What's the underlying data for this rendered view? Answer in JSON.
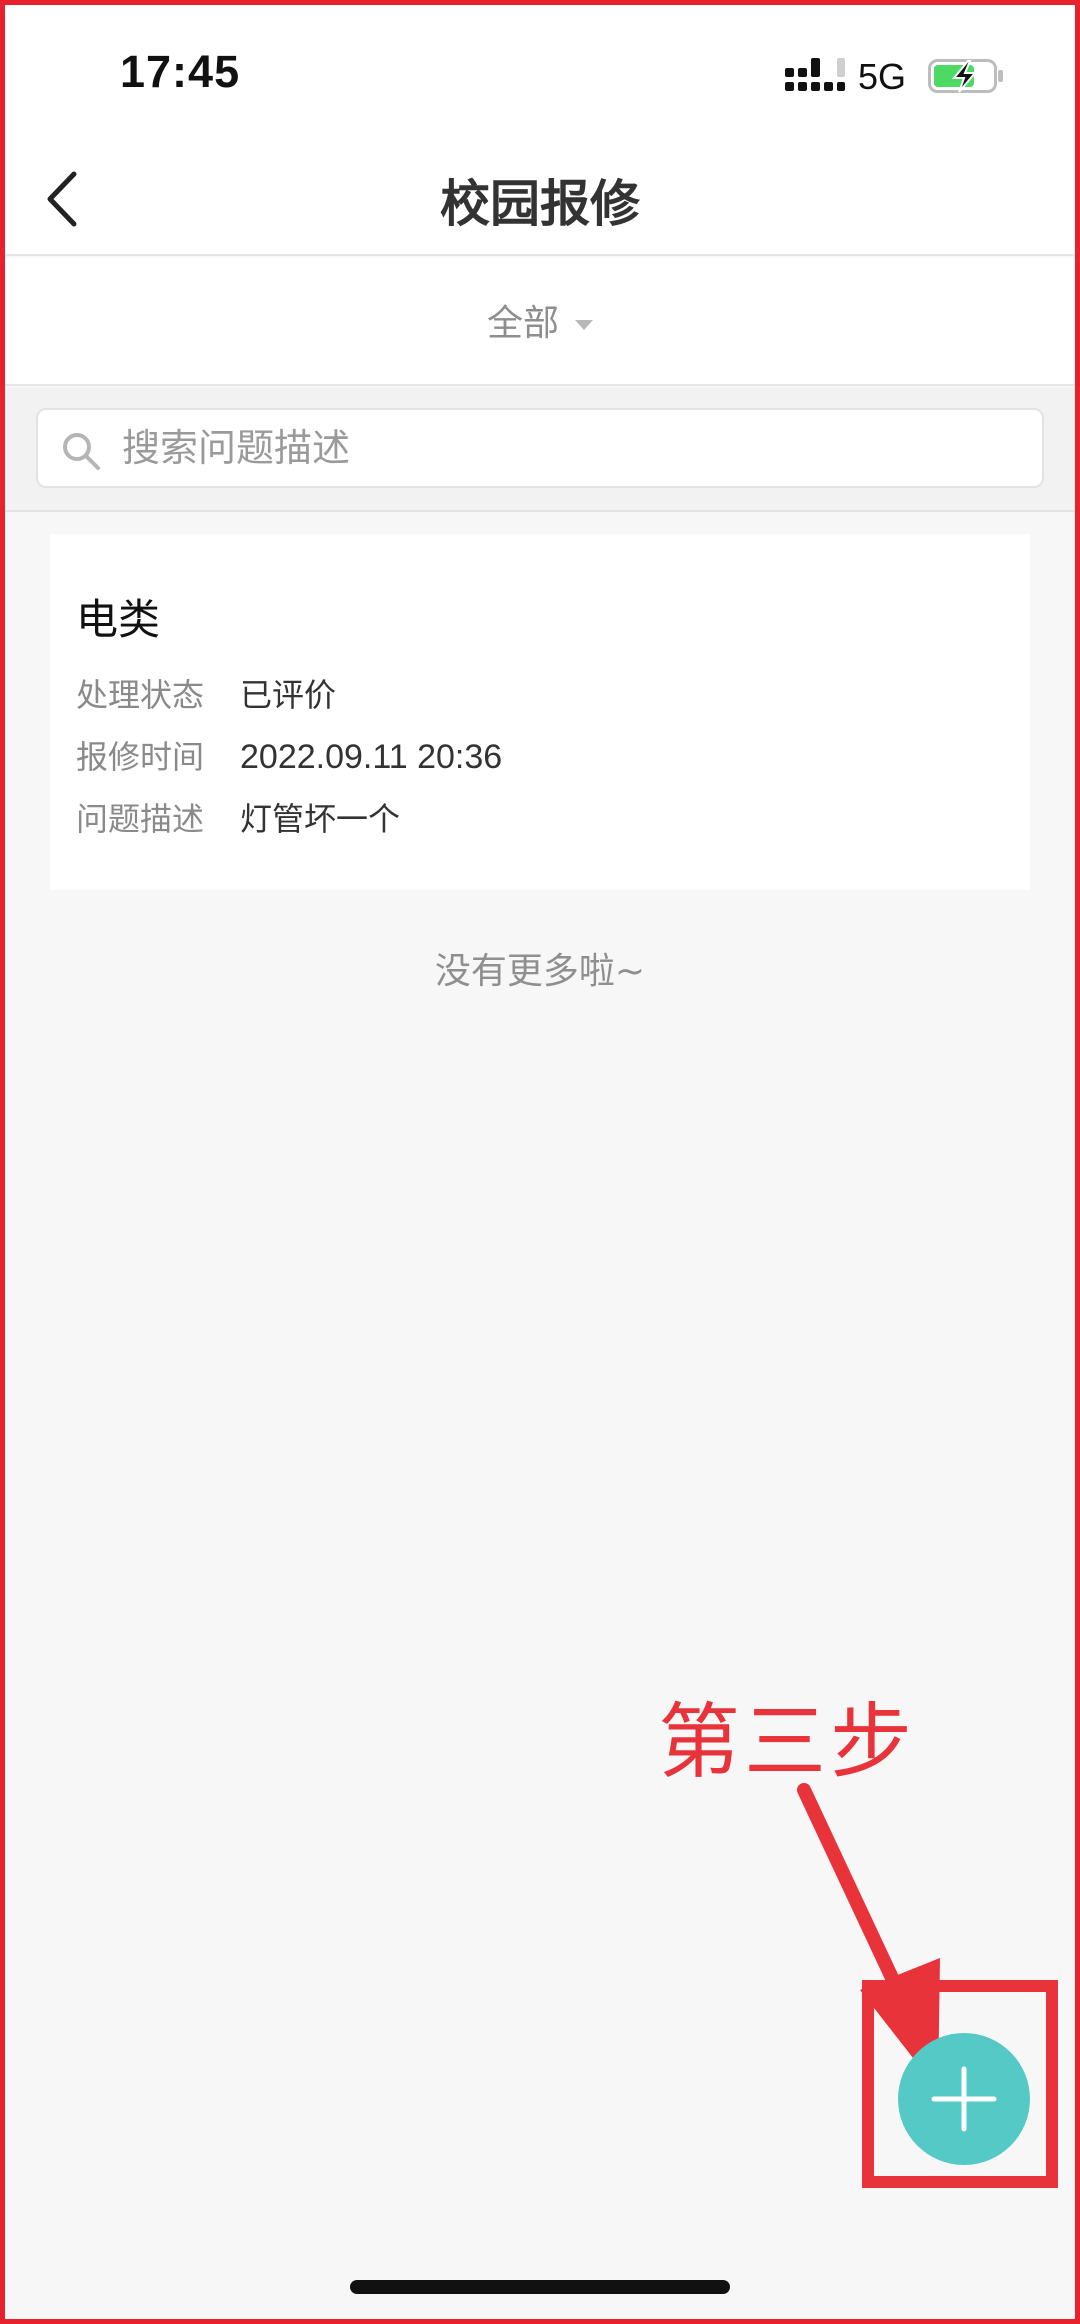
{
  "status_bar": {
    "time": "17:45",
    "network": "5G",
    "signal_icon": "signal-icon",
    "battery_icon": "battery-charging-icon",
    "battery_color": "#4cd964"
  },
  "nav": {
    "title": "校园报修",
    "back_icon": "chevron-left-icon"
  },
  "filter": {
    "selected": "全部",
    "caret_icon": "caret-down-icon"
  },
  "search": {
    "placeholder": "搜索问题描述",
    "value": "",
    "icon": "search-icon"
  },
  "records": [
    {
      "category": "电类",
      "fields": [
        {
          "label": "处理状态",
          "value": "已评价"
        },
        {
          "label": "报修时间",
          "value": "2022.09.11 20:36"
        },
        {
          "label": "问题描述",
          "value": "灯管坏一个"
        }
      ]
    }
  ],
  "list_end_text": "没有更多啦~",
  "annotation": {
    "text": "第三步",
    "color": "#e8333a"
  },
  "fab": {
    "icon": "plus-icon",
    "color": "#55c9c5"
  }
}
